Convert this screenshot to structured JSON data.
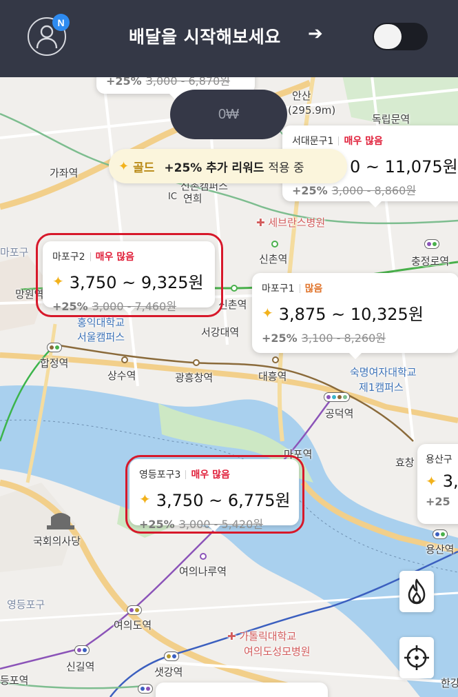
{
  "header": {
    "badge": "N",
    "title": "배달을 시작해보세요",
    "arrow": "➔"
  },
  "earnings": "0₩",
  "gold_banner": {
    "icon": "sparkle-icon",
    "tier": "골드",
    "bonus": "+25% 추가 리워드",
    "suffix": "적용 중"
  },
  "zones": [
    {
      "name": "서대문구1",
      "level": "매우 많음",
      "level_type": "high",
      "price": "0 ~ 11,075원",
      "bonus": "+25%",
      "old": "3,000 - 8,860원"
    },
    {
      "name": "마포구2",
      "level": "매우 많음",
      "level_type": "high",
      "price": "3,750 ~ 9,325원",
      "bonus": "+25%",
      "old": "3,000 - 7,460원"
    },
    {
      "name": "마포구1",
      "level": "많음",
      "level_type": "mid",
      "price": "3,875 ~ 10,325원",
      "bonus": "+25%",
      "old": "3,100 - 8,260원"
    },
    {
      "name": "영등포구3",
      "level": "매우 많음",
      "level_type": "high",
      "price": "3,750 ~ 6,775원",
      "bonus": "+25%",
      "old": "3,000 - 5,420원"
    },
    {
      "name": "용산구",
      "price": "3,",
      "bonus": "+25"
    }
  ],
  "top_partial_card": {
    "bonus": "+25%",
    "old": "3,000 - 6,870원"
  },
  "map_labels": {
    "ansan": "안산",
    "ansan_height": "(295.9m)",
    "dongnimmun": "독립문역",
    "gajwa": "가좌역",
    "sinchon_campus": "신촌캠퍼스",
    "yeonhui": "연희",
    "ic": "IC",
    "severance": "세브란스병원",
    "mapo_district": "마포구",
    "sinchon_station": "신촌역",
    "chungjeongno": "충정로역",
    "mangwon": "망원역",
    "hongik_univ": "홍익대학교",
    "seoul_campus": "서울캠퍼스",
    "sinchon2": "신촌역",
    "seogang_univ": "서강대역",
    "hapjeong": "합정역",
    "sangsu": "상수역",
    "gwangheungchang": "광흥창역",
    "daeheung": "대흥역",
    "sookmyung": "숙명여자대학교",
    "sookmyung_campus": "제1캠퍼스",
    "gongdeok": "공덕역",
    "mapo_station": "마포역",
    "hyochang": "효창",
    "national_assembly": "국회의사당",
    "yeouinaru": "여의나루역",
    "yeongdeungpo_district": "영등포구",
    "yeouido": "여의도역",
    "catholic_univ": "가톨릭대학교",
    "yeouido_hospital": "여의도성모병원",
    "yongsan_station": "용산역",
    "singil": "신길역",
    "saetgang": "샛강역",
    "deungpo": "등포역",
    "ggang": "한강"
  },
  "fabs": {
    "hotspot": "flame-icon",
    "locate": "crosshair-icon"
  },
  "colors": {
    "header_bg": "#343846",
    "highlight": "#d7182a",
    "level_high": "#e0203a",
    "level_mid": "#e0742b",
    "gold": "#b98a16",
    "river": "#a9d0ee",
    "park": "#cde8c4"
  }
}
